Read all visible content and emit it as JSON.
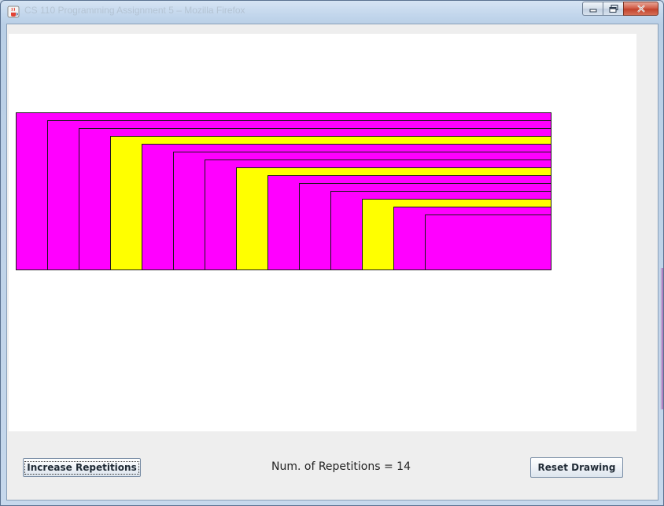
{
  "window": {
    "title": "CS 110 Programming Assignment 5 – Mozilla Firefox",
    "app_icon": "java-coffee-icon",
    "buttons": {
      "minimize": "minimize-icon",
      "maximize": "maximize-icon",
      "close": "close-icon"
    }
  },
  "drawing": {
    "colors": {
      "primary": "#FF00FF",
      "alternate": "#FFFF00",
      "outline": "#1a1a1a",
      "background": "#FFFFFF"
    },
    "rectangles": [
      {
        "fill": "#FF00FF"
      },
      {
        "fill": "#FF00FF"
      },
      {
        "fill": "#FF00FF"
      },
      {
        "fill": "#FFFF00"
      },
      {
        "fill": "#FF00FF"
      },
      {
        "fill": "#FF00FF"
      },
      {
        "fill": "#FF00FF"
      },
      {
        "fill": "#FFFF00"
      },
      {
        "fill": "#FF00FF"
      },
      {
        "fill": "#FF00FF"
      },
      {
        "fill": "#FF00FF"
      },
      {
        "fill": "#FFFF00"
      },
      {
        "fill": "#FF00FF"
      },
      {
        "fill": "#FF00FF"
      }
    ]
  },
  "controls": {
    "increase_label": "Increase Repetitions",
    "reps_label": "Num. of Repetitions = 14",
    "reset_label": "Reset Drawing"
  }
}
